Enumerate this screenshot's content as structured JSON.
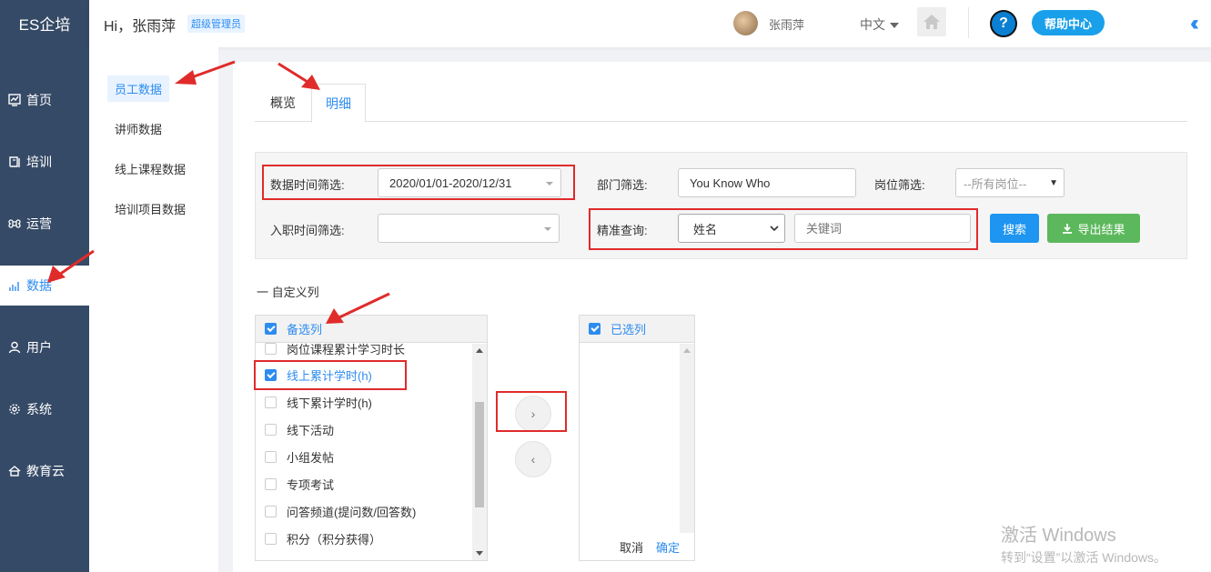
{
  "nav": {
    "logo": "ES企培",
    "items": [
      {
        "label": "首页",
        "icon": "chart-line-icon"
      },
      {
        "label": "培训",
        "icon": "book-icon"
      },
      {
        "label": "运营",
        "icon": "command-icon"
      },
      {
        "label": "数据",
        "icon": "bar-chart-icon",
        "active": true
      },
      {
        "label": "用户",
        "icon": "user-icon"
      },
      {
        "label": "系统",
        "icon": "gear-icon"
      },
      {
        "label": "教育云",
        "icon": "cloud-icon"
      }
    ]
  },
  "header": {
    "greeting": "Hi，张雨萍",
    "role": "超级管理员",
    "username": "张雨萍",
    "language": "中文",
    "help_label": "帮助中心",
    "help_q": "?"
  },
  "subnav": {
    "items": [
      {
        "label": "员工数据",
        "active": true
      },
      {
        "label": "讲师数据"
      },
      {
        "label": "线上课程数据"
      },
      {
        "label": "培训项目数据"
      }
    ]
  },
  "tabs": [
    {
      "label": "概览"
    },
    {
      "label": "明细",
      "active": true
    }
  ],
  "filters": {
    "time_label": "数据时间筛选:",
    "time_value": "2020/01/01-2020/12/31",
    "dept_label": "部门筛选:",
    "dept_value": "You Know Who",
    "post_label": "岗位筛选:",
    "post_value": "--所有岗位--",
    "join_label": "入职时间筛选:",
    "join_value": "",
    "precise_label": "精准查询:",
    "precise_type": "姓名",
    "keyword_placeholder": "关键词",
    "search_btn": "搜索",
    "export_btn": "导出结果"
  },
  "custom_columns": {
    "toggle_label": "一 自定义列",
    "available_title": "备选列",
    "available_items": [
      {
        "label": "岗位课程累计学习时长",
        "checked": false
      },
      {
        "label": "线上累计学时(h)",
        "checked": true
      },
      {
        "label": "线下累计学时(h)",
        "checked": false
      },
      {
        "label": "线下活动",
        "checked": false
      },
      {
        "label": "小组发帖",
        "checked": false
      },
      {
        "label": "专项考试",
        "checked": false
      },
      {
        "label": "问答频道(提问数/回答数)",
        "checked": false
      },
      {
        "label": "积分（积分获得）",
        "checked": false
      }
    ],
    "selected_title": "已选列",
    "move_right": "›",
    "move_left": "‹",
    "cancel": "取消",
    "confirm": "确定"
  },
  "watermark": {
    "line1": "激活 Windows",
    "line2": "转到“设置”以激活 Windows。"
  },
  "colors": {
    "nav_bg": "#354a66",
    "accent": "#2d8cf0",
    "annotation_red": "#e02b2b",
    "export_green": "#5cb85c"
  }
}
